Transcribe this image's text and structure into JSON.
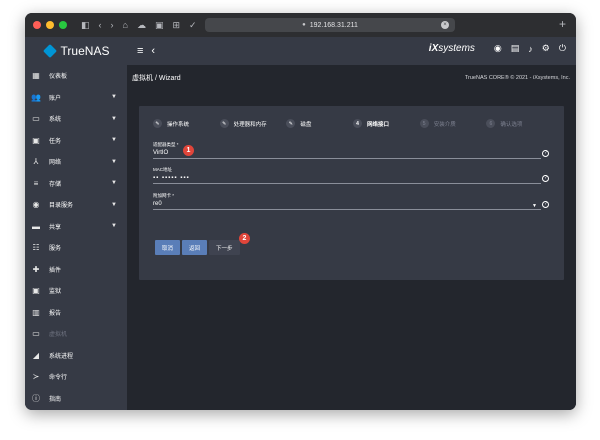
{
  "browser": {
    "address": "192.168.31.211"
  },
  "brand": {
    "name": "TrueNAS",
    "sub": "CORE"
  },
  "vendor": {
    "name_prefix": "iX",
    "name_suffix": "systems"
  },
  "sidebar": {
    "items": [
      {
        "label": "仪表板",
        "icon": "dashboard-icon",
        "glyph": "▦",
        "expandable": false,
        "disabled": false
      },
      {
        "label": "账户",
        "icon": "people-icon",
        "glyph": "👥",
        "expandable": true,
        "disabled": false
      },
      {
        "label": "系统",
        "icon": "laptop-icon",
        "glyph": "▭",
        "expandable": true,
        "disabled": false
      },
      {
        "label": "任务",
        "icon": "calendar-icon",
        "glyph": "▣",
        "expandable": true,
        "disabled": false
      },
      {
        "label": "网络",
        "icon": "network-icon",
        "glyph": "⅄",
        "expandable": true,
        "disabled": false
      },
      {
        "label": "存储",
        "icon": "storage-icon",
        "glyph": "≡",
        "expandable": true,
        "disabled": false
      },
      {
        "label": "目录服务",
        "icon": "directory-icon",
        "glyph": "◉",
        "expandable": true,
        "disabled": false
      },
      {
        "label": "共享",
        "icon": "folder-share-icon",
        "glyph": "▬",
        "expandable": true,
        "disabled": false
      },
      {
        "label": "服务",
        "icon": "tune-icon",
        "glyph": "☷",
        "expandable": false,
        "disabled": false
      },
      {
        "label": "插件",
        "icon": "puzzle-icon",
        "glyph": "✚",
        "expandable": false,
        "disabled": false
      },
      {
        "label": "监狱",
        "icon": "jail-icon",
        "glyph": "▣",
        "expandable": false,
        "disabled": false
      },
      {
        "label": "报告",
        "icon": "report-icon",
        "glyph": "▥",
        "expandable": false,
        "disabled": false
      },
      {
        "label": "虚拟机",
        "icon": "computer-icon",
        "glyph": "▭",
        "expandable": false,
        "disabled": true
      },
      {
        "label": "系统进程",
        "icon": "process-icon",
        "glyph": "◢",
        "expandable": false,
        "disabled": false
      },
      {
        "label": "命令行",
        "icon": "terminal-icon",
        "glyph": "≻",
        "expandable": false,
        "disabled": false
      },
      {
        "label": "指南",
        "icon": "info-icon",
        "glyph": "ⓘ",
        "expandable": false,
        "disabled": false
      }
    ]
  },
  "breadcrumb": {
    "text": "虚拟机 / Wizard"
  },
  "copyright": "TrueNAS CORE® © 2021 - iXsystems, Inc.",
  "wizard": {
    "steps": [
      {
        "label": "操作系统",
        "state": "done",
        "marker": "✎"
      },
      {
        "label": "处理器和内存",
        "state": "done",
        "marker": "✎"
      },
      {
        "label": "磁盘",
        "state": "done",
        "marker": "✎"
      },
      {
        "label": "网络接口",
        "state": "active",
        "marker": "4"
      },
      {
        "label": "安装介质",
        "state": "todo",
        "marker": "5"
      },
      {
        "label": "确认选项",
        "state": "todo",
        "marker": "6"
      }
    ],
    "fields": {
      "adapter_type": {
        "label": "适配器类型 *",
        "value": "VirtIO"
      },
      "mac": {
        "label": "MAC地址",
        "value": "▪▪ ▪▪▪▪▪ ▪▪▪"
      },
      "nic": {
        "label": "附加网卡 *",
        "value": "re0"
      }
    },
    "buttons": {
      "cancel": "取消",
      "back": "返回",
      "next": "下一步"
    },
    "annotations": [
      "1",
      "2"
    ]
  }
}
